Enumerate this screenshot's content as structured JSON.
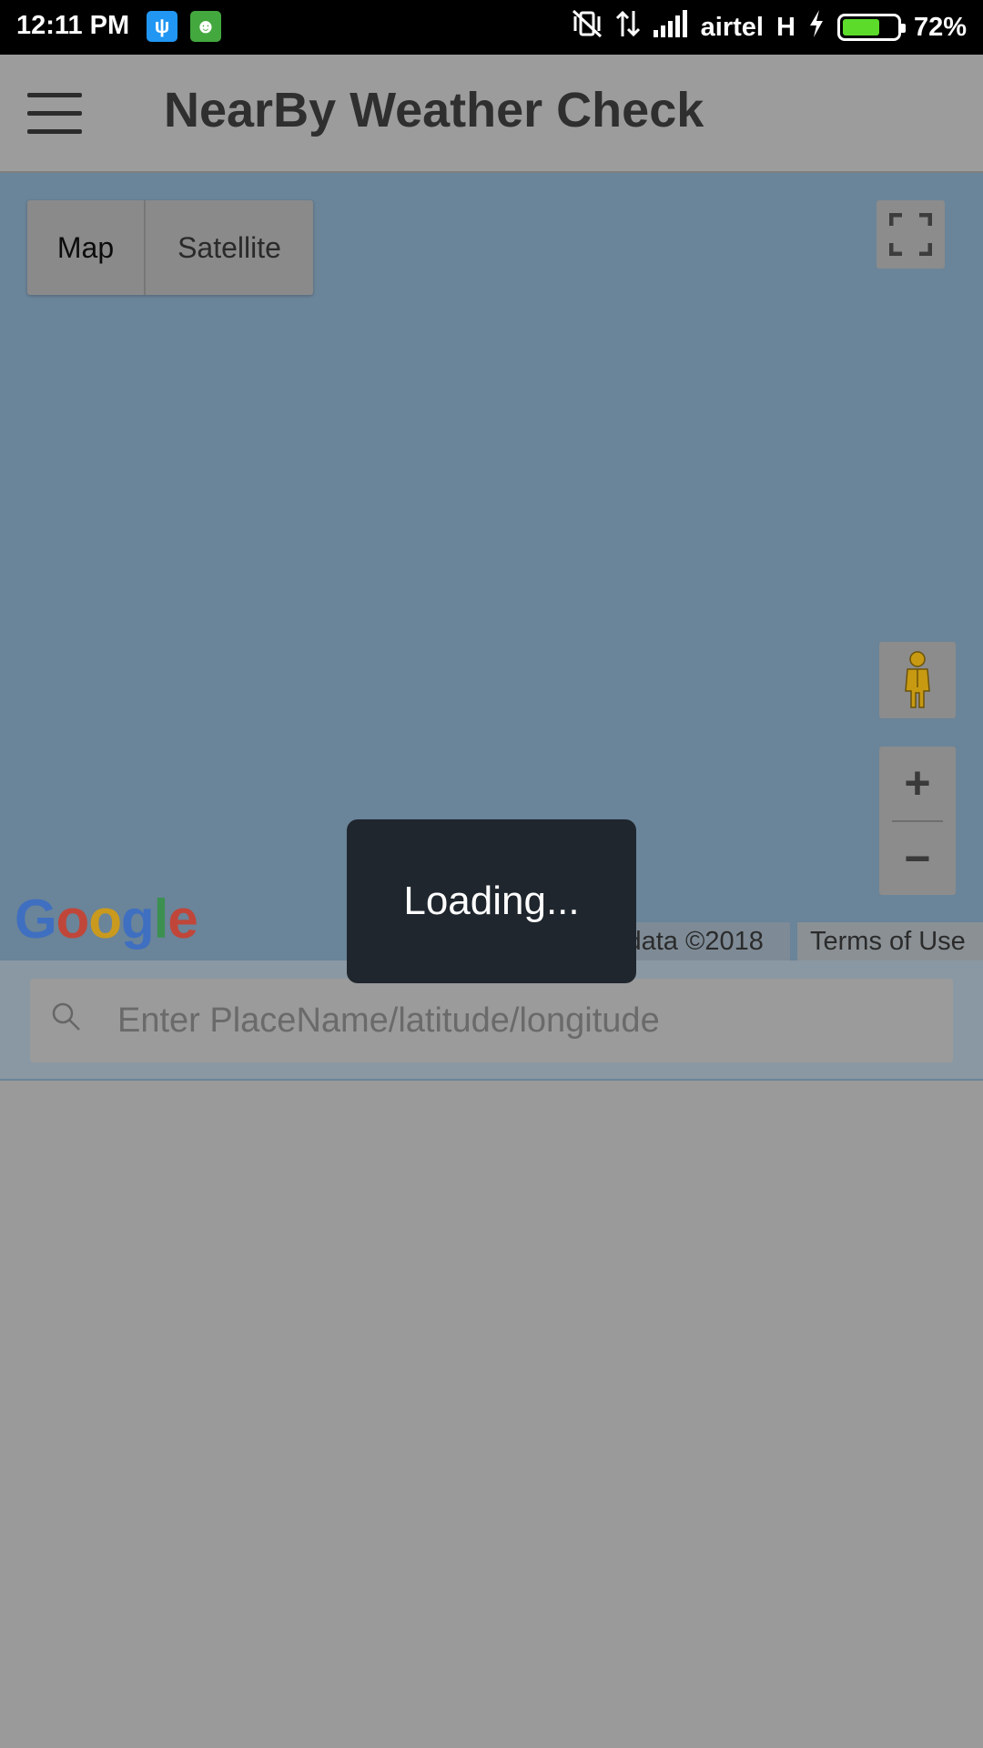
{
  "status_bar": {
    "time": "12:11 PM",
    "carrier": "airtel",
    "network_type": "H",
    "battery_percent": "72%",
    "battery_level": 0.72
  },
  "app_bar": {
    "title": "NearBy Weather Check"
  },
  "map": {
    "type_options": [
      "Map",
      "Satellite"
    ],
    "selected_type": "Map",
    "zoom_in_label": "+",
    "zoom_out_label": "−",
    "logo_text": "Google",
    "attribution": "Map data ©2018",
    "terms": "Terms of Use"
  },
  "search": {
    "placeholder": "Enter PlaceName/latitude/longitude"
  },
  "loading": {
    "text": "Loading..."
  },
  "colors": {
    "map_background": "#6a8499",
    "toast_background": "#1f262e",
    "battery_fill": "#5cdb2b"
  }
}
